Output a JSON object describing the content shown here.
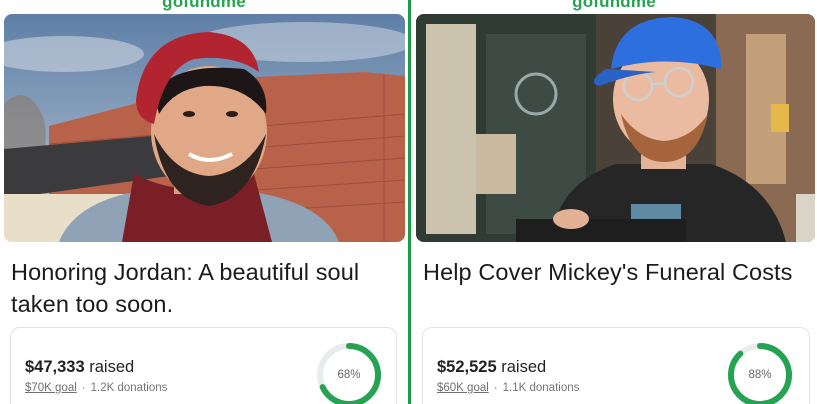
{
  "brand": {
    "name": "gofundme",
    "color": "#26a352"
  },
  "campaigns": [
    {
      "title": "Honoring Jordan: A beautiful soul taken too soon.",
      "raised_amount": "$47,333",
      "raised_suffix": "raised",
      "goal": "$70K goal",
      "donations": "1.2K donations",
      "progress_percent": 68,
      "progress_label": "68%"
    },
    {
      "title": "Help Cover Mickey's Funeral Costs",
      "raised_amount": "$52,525",
      "raised_suffix": "raised",
      "goal": "$60K goal",
      "donations": "1.1K donations",
      "progress_percent": 88,
      "progress_label": "88%"
    }
  ]
}
